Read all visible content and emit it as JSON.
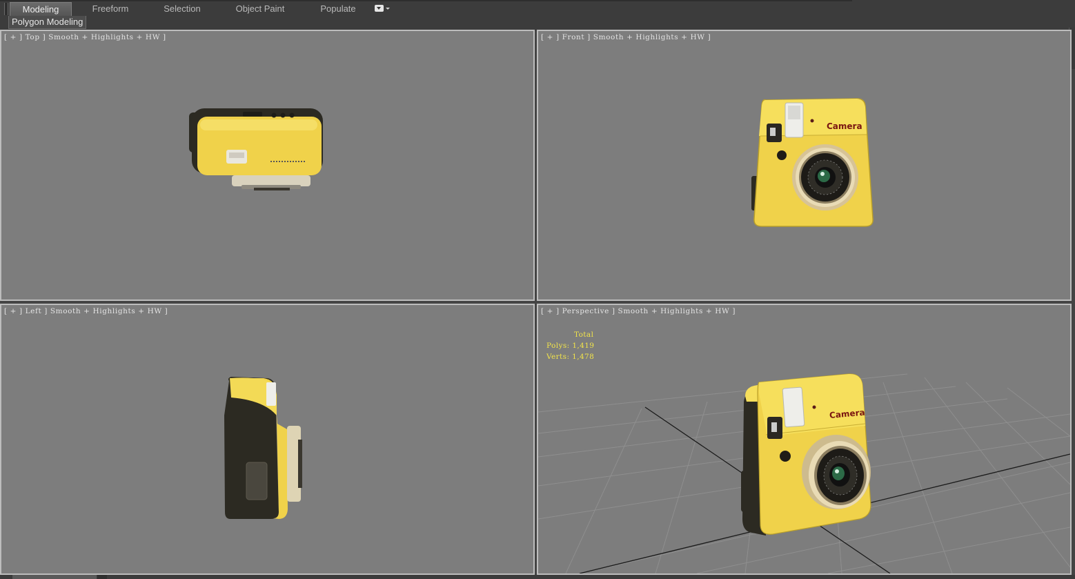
{
  "ribbon": {
    "tabs": [
      {
        "label": "Modeling",
        "active": true
      },
      {
        "label": "Freeform",
        "active": false
      },
      {
        "label": "Selection",
        "active": false
      },
      {
        "label": "Object Paint",
        "active": false
      },
      {
        "label": "Populate",
        "active": false
      }
    ],
    "subpanel_label": "Polygon Modeling",
    "dropdown_icon": "caret-down-icon"
  },
  "viewports": {
    "top": {
      "label": "[ + ] Top ] Smooth + Highlights + HW ]"
    },
    "front": {
      "label": "[ + ] Front ] Smooth + Highlights + HW ]"
    },
    "left": {
      "label": "[ + ] Left ] Smooth + Highlights + HW ]"
    },
    "perspective": {
      "label": "[ + ] Perspective ] Smooth + Highlights + HW ]"
    }
  },
  "stats": {
    "total_label": "Total",
    "polys": "Polys: 1,419",
    "verts": "Verts: 1,478"
  },
  "model": {
    "camera_text": "Camera",
    "body_color": "#f0d24a",
    "dark_color": "#2c2a22"
  },
  "colors": {
    "viewport_bg": "#7d7d7d",
    "stats_text": "#f1e34a",
    "ui_bg": "#444444"
  }
}
